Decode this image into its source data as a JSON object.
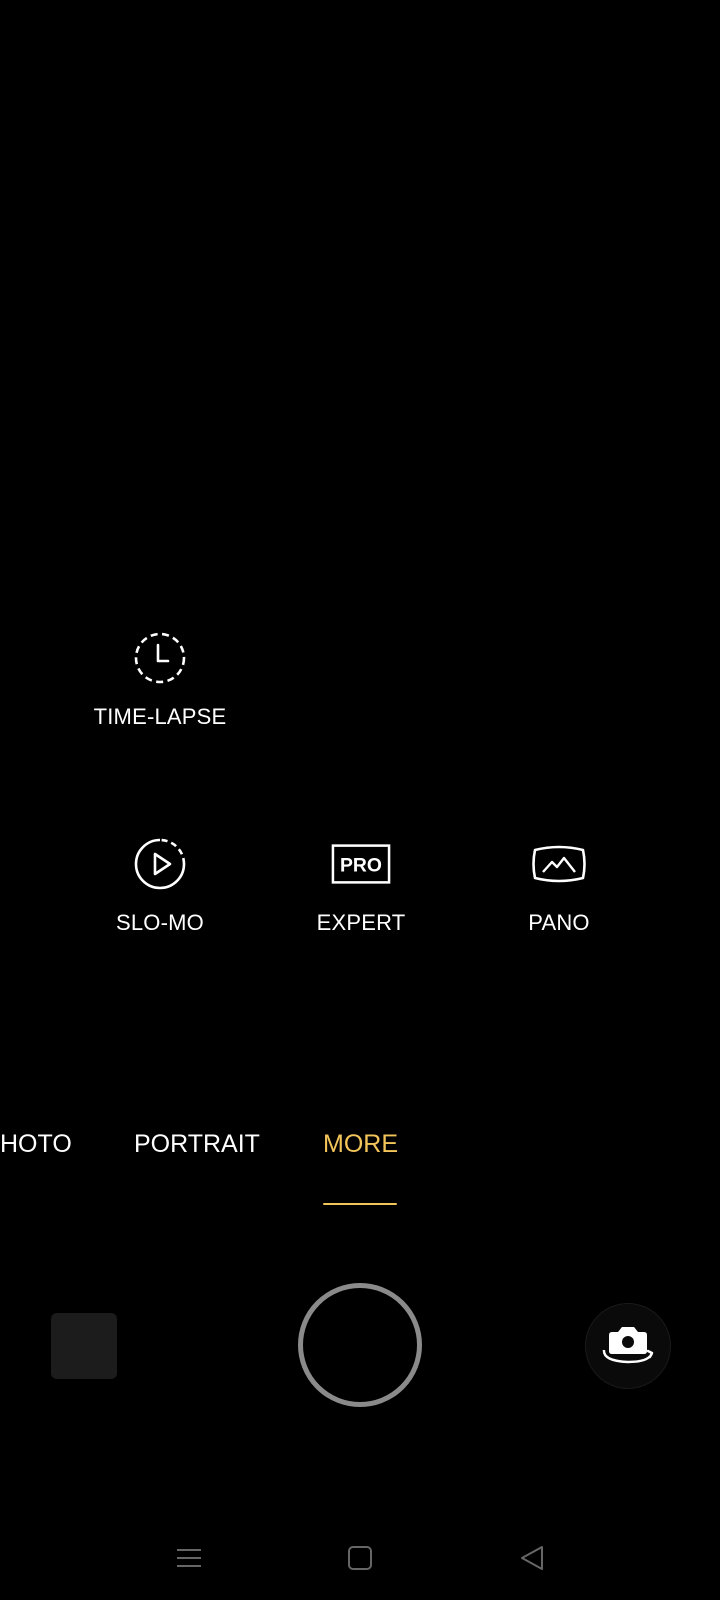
{
  "modes_grid": [
    {
      "id": "time-lapse",
      "label": "TIME-LAPSE",
      "icon": "timelapse-icon"
    },
    {
      "id": "slo-mo",
      "label": "SLO-MO",
      "icon": "slo-mo-icon"
    },
    {
      "id": "expert",
      "label": "EXPERT",
      "icon": "pro-icon",
      "icon_text": "PRO"
    },
    {
      "id": "pano",
      "label": "PANO",
      "icon": "pano-icon"
    }
  ],
  "mode_tabs": [
    {
      "label": "HOTO",
      "active": false
    },
    {
      "label": "PORTRAIT",
      "active": false
    },
    {
      "label": "MORE",
      "active": true
    }
  ],
  "colors": {
    "accent": "#f3c45a",
    "background": "#000000",
    "shutter_ring": "#8a8a8a"
  },
  "nav": {
    "recents": "menu-icon",
    "home": "square-icon",
    "back": "back-triangle-icon"
  }
}
